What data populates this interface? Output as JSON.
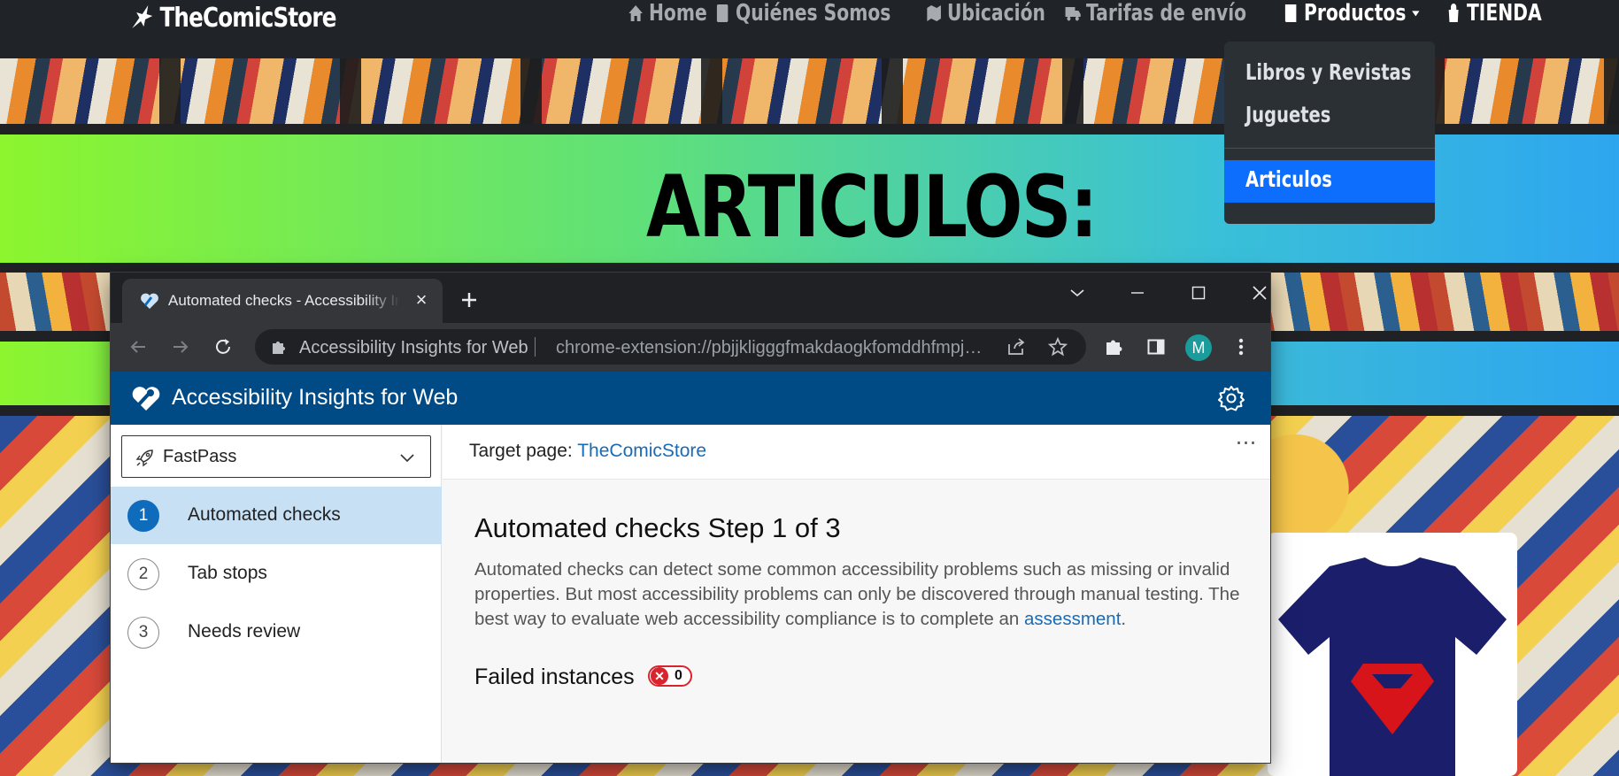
{
  "site": {
    "brand": "TheComicStore",
    "nav": [
      {
        "label": "Home",
        "icon": "home-icon"
      },
      {
        "label": "Quiénes Somos",
        "icon": "id-card-icon"
      },
      {
        "label": "Ubicación",
        "icon": "map-icon"
      },
      {
        "label": "Tarifas de envío",
        "icon": "truck-icon"
      },
      {
        "label": "Productos",
        "icon": "book-icon"
      },
      {
        "label": "TIENDA",
        "icon": "shopping-bag-icon"
      }
    ],
    "hero_title": "ARTICULOS:",
    "dropdown": [
      "Libros y Revistas",
      "Juguetes",
      "Articulos"
    ]
  },
  "browser": {
    "tab_title": "Automated checks - Accessibility Insights for Web",
    "omnibox_name": "Accessibility Insights for Web",
    "omnibox_url": "chrome-extension://pbjjkligggfmakdaogkfomddhfmpjeni/DetailsView/detailsView.html",
    "avatar_letter": "M"
  },
  "extension": {
    "title": "Accessibility Insights for Web",
    "mode": "FastPass",
    "steps": [
      {
        "num": "1",
        "label": "Automated checks"
      },
      {
        "num": "2",
        "label": "Tab stops"
      },
      {
        "num": "3",
        "label": "Needs review"
      }
    ],
    "target_label": "Target page: ",
    "target_link": "TheComicStore",
    "more": "⋯",
    "heading": "Automated checks Step 1 of 3",
    "description": "Automated checks can detect some common accessibility problems such as missing or invalid properties. But most accessibility problems can only be discovered through manual testing. The best way to evaluate web accessibility compliance is to complete an ",
    "description_link": "assessment",
    "description_end": ".",
    "failed_label": "Failed instances",
    "failed_count": "0"
  },
  "colors": {
    "accent": "#004a85",
    "selected_step": "#c7e0f4",
    "error": "#d9242e",
    "link": "#1a6bb5"
  }
}
